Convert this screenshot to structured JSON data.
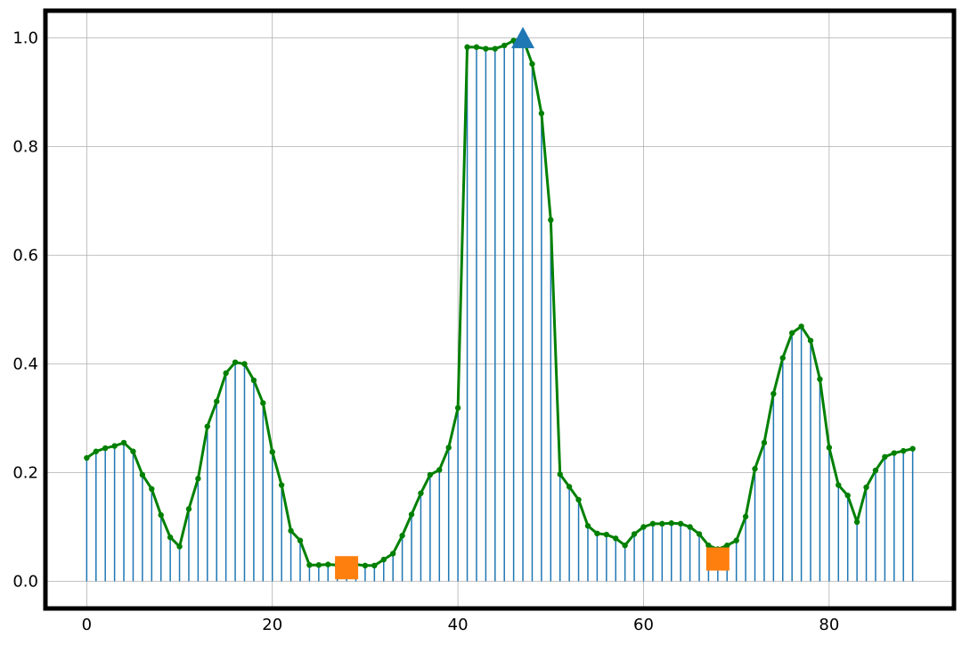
{
  "chart_data": {
    "type": "line",
    "title": "",
    "xlabel": "",
    "ylabel": "",
    "xlim": [
      -4.45,
      93.45
    ],
    "ylim": [
      -0.05,
      1.05
    ],
    "grid": true,
    "legend": "none",
    "x_ticks": [
      0,
      20,
      40,
      60,
      80
    ],
    "y_ticks": [
      0.0,
      0.2,
      0.4,
      0.6,
      0.8,
      1.0
    ],
    "x_tick_labels": [
      "0",
      "20",
      "40",
      "60",
      "80"
    ],
    "y_tick_labels": [
      "0.0",
      "0.2",
      "0.4",
      "0.6",
      "0.8",
      "1.0"
    ],
    "x": [
      0,
      1,
      2,
      3,
      4,
      5,
      6,
      7,
      8,
      9,
      10,
      11,
      12,
      13,
      14,
      15,
      16,
      17,
      18,
      19,
      20,
      21,
      22,
      23,
      24,
      25,
      26,
      27,
      28,
      29,
      30,
      31,
      32,
      33,
      34,
      35,
      36,
      37,
      38,
      39,
      40,
      41,
      42,
      43,
      44,
      45,
      46,
      47,
      48,
      49,
      50,
      51,
      52,
      53,
      54,
      55,
      56,
      57,
      58,
      59,
      60,
      61,
      62,
      63,
      64,
      65,
      66,
      67,
      68,
      69,
      70,
      71,
      72,
      73,
      74,
      75,
      76,
      77,
      78,
      79,
      80,
      81,
      82,
      83,
      84,
      85,
      86,
      87,
      88,
      89
    ],
    "series": [
      {
        "style": "stem",
        "color": "#1f77b4",
        "values": [
          0.227,
          0.239,
          0.245,
          0.249,
          0.255,
          0.239,
          0.196,
          0.17,
          0.122,
          0.081,
          0.064,
          0.133,
          0.189,
          0.285,
          0.331,
          0.383,
          0.403,
          0.4,
          0.37,
          0.328,
          0.238,
          0.177,
          0.093,
          0.075,
          0.03,
          0.03,
          0.031,
          0.03,
          0.03,
          0.031,
          0.029,
          0.029,
          0.04,
          0.051,
          0.084,
          0.123,
          0.162,
          0.196,
          0.205,
          0.246,
          0.319,
          0.983,
          0.983,
          0.98,
          0.98,
          0.986,
          0.995,
          0.999,
          0.952,
          0.861,
          0.665,
          0.197,
          0.174,
          0.15,
          0.102,
          0.088,
          0.086,
          0.079,
          0.066,
          0.087,
          0.1,
          0.106,
          0.106,
          0.107,
          0.106,
          0.1,
          0.087,
          0.066,
          0.059,
          0.066,
          0.075,
          0.119,
          0.207,
          0.255,
          0.345,
          0.411,
          0.457,
          0.469,
          0.443,
          0.372,
          0.246,
          0.177,
          0.158,
          0.109,
          0.173,
          0.204,
          0.229,
          0.236,
          0.24,
          0.244
        ]
      },
      {
        "style": "line-with-dots",
        "color": "#008000",
        "values": [
          0.227,
          0.239,
          0.245,
          0.249,
          0.255,
          0.239,
          0.196,
          0.17,
          0.122,
          0.081,
          0.064,
          0.133,
          0.189,
          0.285,
          0.331,
          0.383,
          0.403,
          0.4,
          0.37,
          0.328,
          0.238,
          0.177,
          0.093,
          0.075,
          0.03,
          0.03,
          0.031,
          0.03,
          0.03,
          0.031,
          0.029,
          0.029,
          0.04,
          0.051,
          0.084,
          0.123,
          0.162,
          0.196,
          0.205,
          0.246,
          0.319,
          0.983,
          0.983,
          0.98,
          0.98,
          0.986,
          0.995,
          0.999,
          0.952,
          0.861,
          0.665,
          0.197,
          0.174,
          0.15,
          0.102,
          0.088,
          0.086,
          0.079,
          0.066,
          0.087,
          0.1,
          0.106,
          0.106,
          0.107,
          0.106,
          0.1,
          0.087,
          0.066,
          0.059,
          0.066,
          0.075,
          0.119,
          0.207,
          0.255,
          0.345,
          0.411,
          0.457,
          0.469,
          0.443,
          0.372,
          0.246,
          0.177,
          0.158,
          0.109,
          0.173,
          0.204,
          0.229,
          0.236,
          0.24,
          0.244
        ]
      }
    ],
    "markers": [
      {
        "shape": "triangle",
        "color": "#1f77b4",
        "x": 47,
        "y": 0.999
      },
      {
        "shape": "square",
        "color": "#ff7f0e",
        "x": 28,
        "y": 0.025
      },
      {
        "shape": "square",
        "color": "#ff7f0e",
        "x": 68,
        "y": 0.041
      }
    ]
  }
}
